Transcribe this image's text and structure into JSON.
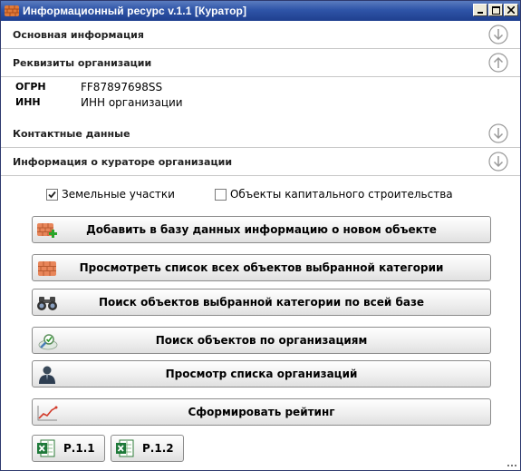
{
  "window": {
    "title": "Информационный ресурс v.1.1 [Куратор]",
    "accent": "#2f55a8"
  },
  "sections": [
    {
      "label": "Основная информация",
      "state": "collapsed"
    },
    {
      "label": "Реквизиты организации",
      "state": "expanded"
    },
    {
      "label": "Контактные данные",
      "state": "collapsed"
    },
    {
      "label": "Информация о кураторе организации",
      "state": "collapsed"
    }
  ],
  "requisites": [
    {
      "key": "ОГРН",
      "value": "FF87897698SS"
    },
    {
      "key": "ИНН",
      "value": "ИНН организации"
    }
  ],
  "checkboxes": [
    {
      "label": "Земельные участки",
      "checked": true
    },
    {
      "label": "Объекты капитального строительства",
      "checked": false
    }
  ],
  "actions": [
    {
      "label": "Добавить в базу данных информацию о новом объекте",
      "icon": "add-brick-icon"
    },
    {
      "label": "Просмотреть список всех объектов выбранной категории",
      "icon": "brick-icon"
    },
    {
      "label": "Поиск объектов выбранной категории по всей базе",
      "icon": "binoculars-icon"
    },
    {
      "label": "Поиск объектов по организациям",
      "icon": "search-organizations-icon"
    },
    {
      "label": "Просмотр списка организаций",
      "icon": "person-icon"
    },
    {
      "label": "Сформировать рейтинг",
      "icon": "chart-icon"
    }
  ],
  "reports": [
    {
      "label": "Р.1.1",
      "icon": "excel-icon"
    },
    {
      "label": "Р.1.2",
      "icon": "excel-icon"
    }
  ]
}
